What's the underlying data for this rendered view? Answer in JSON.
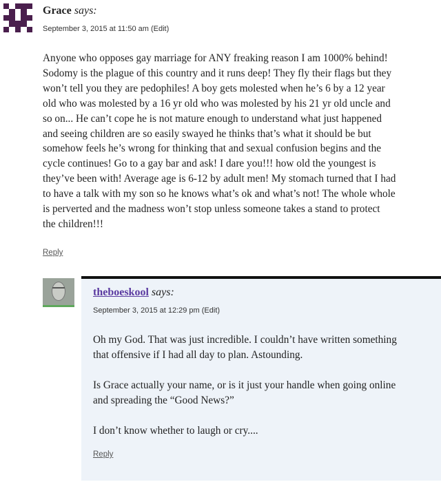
{
  "comment": {
    "author": "Grace",
    "says": "says:",
    "meta": "September 3, 2015 at 11:50 am (Edit)",
    "body_lines": [
      "Anyone who opposes gay marriage for ANY freaking reason I am 1000% behind!",
      "Sodomy is the plague of this country and it runs deep! They fly their flags but they",
      "won’t tell you they are pedophiles! A boy gets molested when he’s 6 by a 12 year",
      "old who was molested by a 16 yr old who was molested by his 21 yr old uncle and",
      "so on... He can’t cope he is not mature enough to understand what just happened",
      "and seeing children are so easily swayed he thinks that’s what it should be but",
      "somehow feels he’s wrong for thinking that and sexual confusion begins and the",
      "cycle continues! Go to a gay bar and ask! I dare you!!! how old the youngest is",
      "they’ve been with! Average age is 6-12 by adult men! My stomach turned that I had",
      "to have a talk with my son so he knows what’s ok and what’s not! The whole whole",
      "is perverted and the madness won’t stop unless someone takes a stand to protect",
      "the children!!!"
    ],
    "reply_label": "Reply"
  },
  "reply": {
    "author": "theboeskool",
    "says": "says:",
    "meta": "September 3, 2015 at 12:29 pm (Edit)",
    "paragraphs": [
      [
        "Oh my God. That was just incredible. I couldn’t have written something",
        "that offensive if I had all day to plan. Astounding."
      ],
      [
        "Is Grace actually your name, or is it just your handle when going online",
        "and spreading the “Good News?”"
      ],
      [
        "I don’t know whether to laugh or cry...."
      ]
    ],
    "reply_label": "Reply"
  },
  "colors": {
    "identicon": "#4a1f4d",
    "reply_author_link": "#5a3aa0",
    "reply_background": "#eef3f9",
    "reply_top_border": "#111111"
  },
  "icons": {
    "grace_avatar": "identicon-avatar-icon",
    "reply_avatar": "user-photo-avatar"
  }
}
